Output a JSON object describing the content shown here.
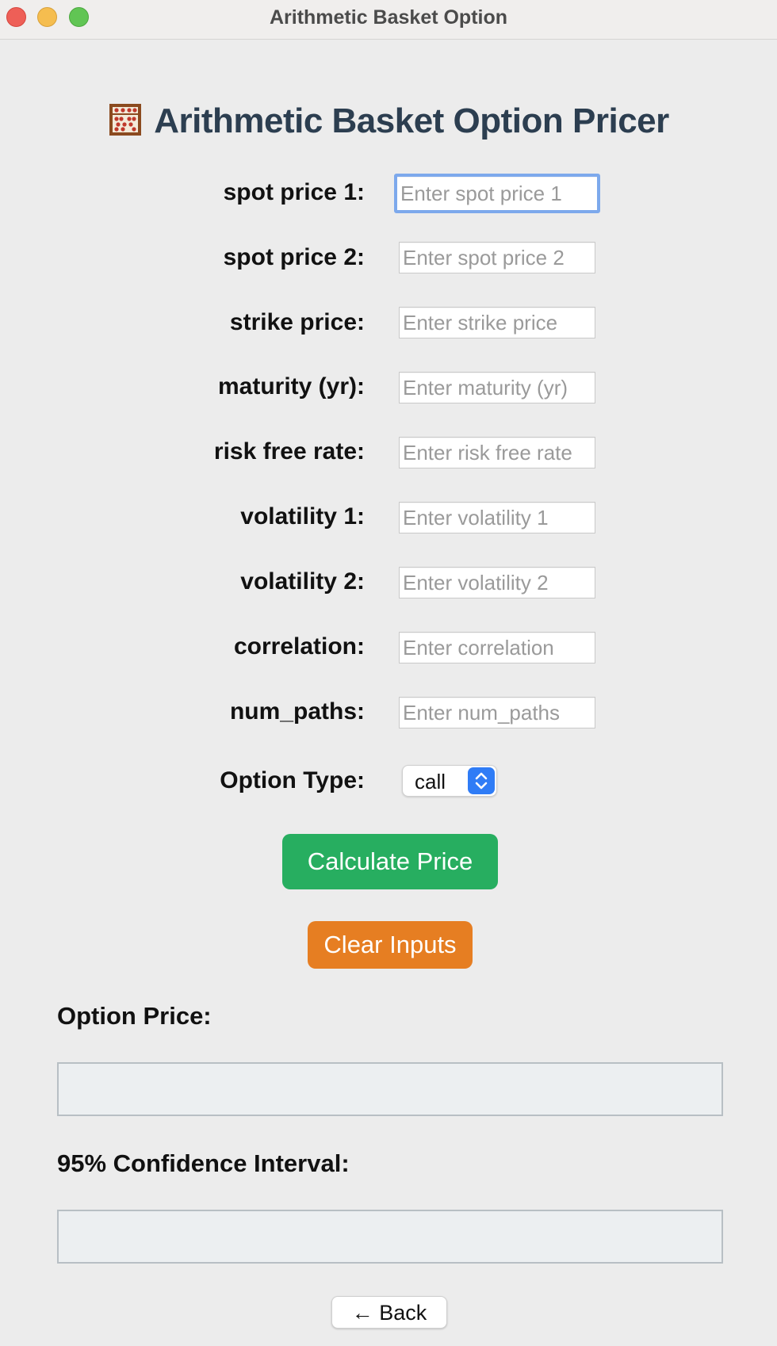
{
  "window": {
    "title": "Arithmetic Basket Option"
  },
  "header": {
    "title": "Arithmetic Basket Option Pricer",
    "icon": "abacus-icon"
  },
  "form": {
    "fields": [
      {
        "label": "spot price 1:",
        "placeholder": "Enter spot price 1",
        "value": ""
      },
      {
        "label": "spot price 2:",
        "placeholder": "Enter spot price 2",
        "value": ""
      },
      {
        "label": "strike price:",
        "placeholder": "Enter strike price",
        "value": ""
      },
      {
        "label": "maturity (yr):",
        "placeholder": "Enter maturity (yr)",
        "value": ""
      },
      {
        "label": "risk free rate:",
        "placeholder": "Enter risk free rate",
        "value": ""
      },
      {
        "label": "volatility 1:",
        "placeholder": "Enter volatility 1",
        "value": ""
      },
      {
        "label": "volatility 2:",
        "placeholder": "Enter volatility 2",
        "value": ""
      },
      {
        "label": "correlation:",
        "placeholder": "Enter correlation",
        "value": ""
      },
      {
        "label": "num_paths:",
        "placeholder": "Enter num_paths",
        "value": ""
      }
    ],
    "option_type": {
      "label": "Option Type:",
      "selected": "call"
    }
  },
  "actions": {
    "calculate_label": "Calculate Price",
    "clear_label": "Clear Inputs"
  },
  "results": {
    "price_label": "Option Price:",
    "price_value": "",
    "ci_label": "95% Confidence Interval:",
    "ci_value": ""
  },
  "nav": {
    "back_label": "← Back"
  },
  "colors": {
    "calculate": "#27ae60",
    "clear": "#e67e22",
    "heading": "#2c3e50",
    "focus_ring": "#7da9ec",
    "select_accent": "#2f7cf6"
  }
}
